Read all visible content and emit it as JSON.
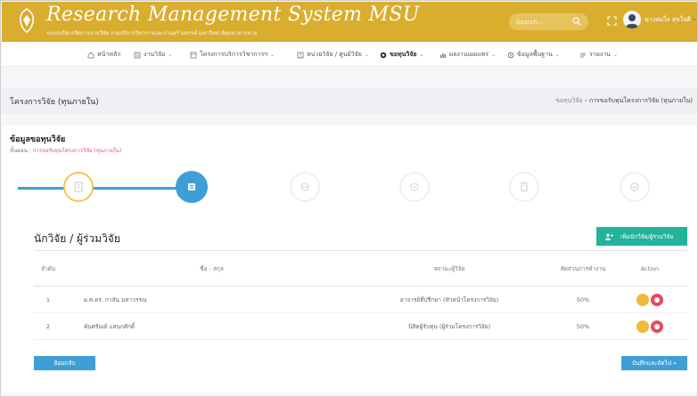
{
  "header": {
    "title": "Research Management System MSU",
    "subtitle": "ระบบบริหารจัดการงานวิจัย งานบริการวิชาการและงานสร้างสรรค์ มหาวิทยาลัยมหาสารคาม",
    "search_placeholder": "Search...",
    "user_name": "นางสมใจ สุขใจดี"
  },
  "nav": {
    "items": [
      {
        "label": "หน้าหลัก",
        "icon": "home-icon"
      },
      {
        "label": "งานวิจัย",
        "icon": "list-icon"
      },
      {
        "label": "โครงการบริการวิชาการฯ",
        "icon": "doc-icon"
      },
      {
        "label": "หน่วยวิจัย / ศูนย์วิจัย",
        "icon": "building-icon"
      },
      {
        "label": "ขอทุนวิจัย",
        "icon": "target-icon"
      },
      {
        "label": "ผลงานเผยแพร่",
        "icon": "chart-icon"
      },
      {
        "label": "ข้อมูลพื้นฐาน",
        "icon": "gear-icon"
      },
      {
        "label": "รายงาน",
        "icon": "report-icon"
      }
    ]
  },
  "page": {
    "title": "โครงการวิจัย (ทุนภายใน)",
    "breadcrumb": [
      "ขอทุนวิจัย",
      "การขอรับทุนโครงการวิจัย (ทุนภายใน)"
    ]
  },
  "section": {
    "title": "ข้อมูลขอทุนวิจัย",
    "sub_label": "ขั้นตอน :",
    "sub_value": "การขอรับทุนโครงการวิจัย (ทุนภายใน)"
  },
  "stepper": {
    "current_step": 2,
    "total_steps": 6
  },
  "researchers": {
    "title": "นักวิจัย / ผู้ร่วมวิจัย",
    "add_button": "เพิ่มนักวิจัย/ผู้ร่วมวิจัย",
    "columns": [
      "ลำดับ",
      "ชื่อ - สกุล",
      "สถานะผู้วิจัย",
      "สัดส่วนการทำงาน",
      "Action"
    ],
    "rows": [
      {
        "no": "1",
        "name": "ผ.ศ.ดร. กาลัน มหาวรรณ",
        "role": "อาจารย์ที่ปรึกษา (หัวหน้าโครงการวิจัย)",
        "percent": "50%"
      },
      {
        "no": "2",
        "name": "คันศรัณย์ แสนกศักดิ์",
        "role": "นิสิตผู้รับทุน (ผู้ร่วมโครงการวิจัย)",
        "percent": "50%"
      }
    ]
  },
  "footer": {
    "prev_button": "ย้อนกลับ",
    "next_button": "บันทึกและถัดไป »"
  },
  "colors": {
    "header": "#d9ad2e",
    "primary": "#3e9fd6",
    "success": "#23b39a",
    "warning": "#f2b83a",
    "danger": "#e94a5c"
  }
}
